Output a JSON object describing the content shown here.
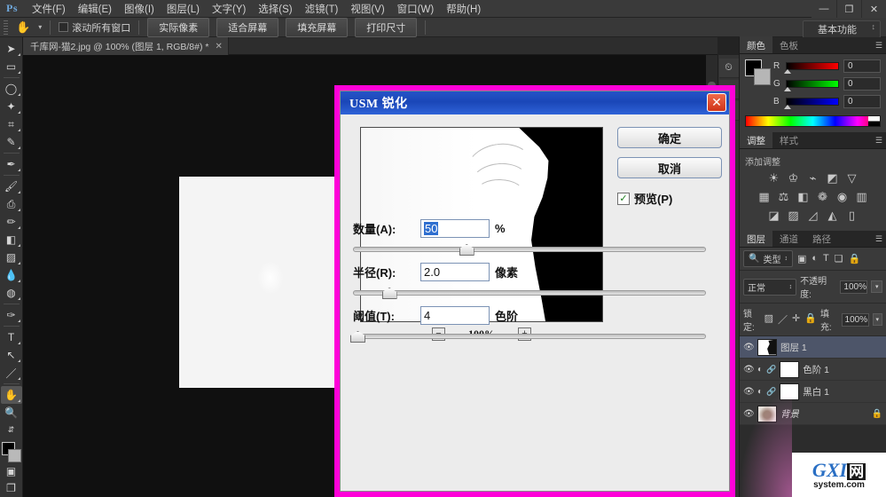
{
  "app": {
    "logo": "Ps",
    "menus": [
      "文件(F)",
      "编辑(E)",
      "图像(I)",
      "图层(L)",
      "文字(Y)",
      "选择(S)",
      "滤镜(T)",
      "视图(V)",
      "窗口(W)",
      "帮助(H)"
    ],
    "window_controls": {
      "minimize": "—",
      "restore": "❐",
      "close": "✕"
    }
  },
  "options_bar": {
    "tool_icon": "hand-tool",
    "scroll_all_windows": "滚动所有窗口",
    "buttons": [
      "实际像素",
      "适合屏幕",
      "填充屏幕",
      "打印尺寸"
    ],
    "workspace": "基本功能"
  },
  "document": {
    "tab_title": "千库网-猫2.jpg @ 100% (图层 1, RGB/8#) *",
    "close_glyph": "✕"
  },
  "toolbar": {
    "tools": [
      {
        "name": "move-tool",
        "glyph": "➤"
      },
      {
        "name": "marquee-tool",
        "glyph": "▭"
      },
      {
        "name": "lasso-tool",
        "glyph": "◯"
      },
      {
        "name": "magic-wand-tool",
        "glyph": "✦"
      },
      {
        "name": "crop-tool",
        "glyph": "⌗"
      },
      {
        "name": "eyedropper-tool",
        "glyph": "✎"
      },
      {
        "name": "healing-brush-tool",
        "glyph": "✒"
      },
      {
        "name": "brush-tool",
        "glyph": "🖌"
      },
      {
        "name": "clone-stamp-tool",
        "glyph": "⎙"
      },
      {
        "name": "history-brush-tool",
        "glyph": "✏"
      },
      {
        "name": "eraser-tool",
        "glyph": "◧"
      },
      {
        "name": "gradient-tool",
        "glyph": "▨"
      },
      {
        "name": "blur-tool",
        "glyph": "💧"
      },
      {
        "name": "dodge-tool",
        "glyph": "◍"
      },
      {
        "name": "pen-tool",
        "glyph": "✑"
      },
      {
        "name": "type-tool",
        "glyph": "T"
      },
      {
        "name": "path-selection-tool",
        "glyph": "↖"
      },
      {
        "name": "line-tool",
        "glyph": "／"
      },
      {
        "name": "hand-tool",
        "glyph": "✋"
      },
      {
        "name": "zoom-tool",
        "glyph": "🔍"
      }
    ],
    "foreground_color": "#000000",
    "background_color": "#b9b9b9"
  },
  "panels": {
    "color": {
      "tabs": [
        "颜色",
        "色板"
      ],
      "active_tab": "颜色",
      "channels": [
        {
          "label": "R",
          "value": "0"
        },
        {
          "label": "G",
          "value": "0"
        },
        {
          "label": "B",
          "value": "0"
        }
      ]
    },
    "adjustments": {
      "tabs": [
        "调整",
        "样式"
      ],
      "active_tab": "调整",
      "subtitle": "添加调整",
      "rows": [
        [
          "☀",
          "♔",
          "⌁",
          "◩",
          "▽"
        ],
        [
          "▦",
          "⚖",
          "◧",
          "❁",
          "◉",
          "▥"
        ],
        [
          "◪",
          "▨",
          "◿",
          "◭",
          "▯"
        ]
      ]
    },
    "layers": {
      "tabs": [
        "图层",
        "通道",
        "路径"
      ],
      "active_tab": "图层",
      "filter_label": "类型",
      "filter_icons": [
        "▣",
        "◐",
        "T",
        "❏",
        "🔒"
      ],
      "blend_mode": "正常",
      "opacity_label": "不透明度:",
      "opacity_value": "100%",
      "lock_label": "锁定:",
      "lock_icons": [
        "▨",
        "／",
        "✛",
        "🔒"
      ],
      "fill_label": "填充:",
      "fill_value": "100%",
      "rows": [
        {
          "name": "图层 1",
          "selected": true,
          "kind": "pixel",
          "locked": false
        },
        {
          "name": "色阶 1",
          "selected": false,
          "kind": "adjustment",
          "locked": false
        },
        {
          "name": "黑白 1",
          "selected": false,
          "kind": "adjustment",
          "locked": false
        },
        {
          "name": "背景",
          "selected": false,
          "kind": "background",
          "locked": true
        }
      ]
    }
  },
  "dialog": {
    "title": "USM 锐化",
    "close_glyph": "✕",
    "ok_label": "确定",
    "cancel_label": "取消",
    "preview_label": "预览(P)",
    "preview_checked": "✓",
    "zoom": {
      "minus": "−",
      "plus": "+",
      "level": "100%"
    },
    "fields": [
      {
        "name": "amount",
        "label": "数量(A):",
        "value": "50",
        "unit": "%",
        "selected": true,
        "knob_pct": 32
      },
      {
        "name": "radius",
        "label": "半径(R):",
        "value": "2.0",
        "unit": "像素",
        "selected": false,
        "knob_pct": 10
      },
      {
        "name": "threshold",
        "label": "阈值(T):",
        "value": "4",
        "unit": "色阶",
        "selected": false,
        "knob_pct": 1
      }
    ],
    "border_color": "#ff00d8",
    "titlebar_color": "#1a47b8"
  },
  "watermark": {
    "g": "G",
    "xi": "XI",
    "box": "网",
    "domain": "system.com"
  }
}
